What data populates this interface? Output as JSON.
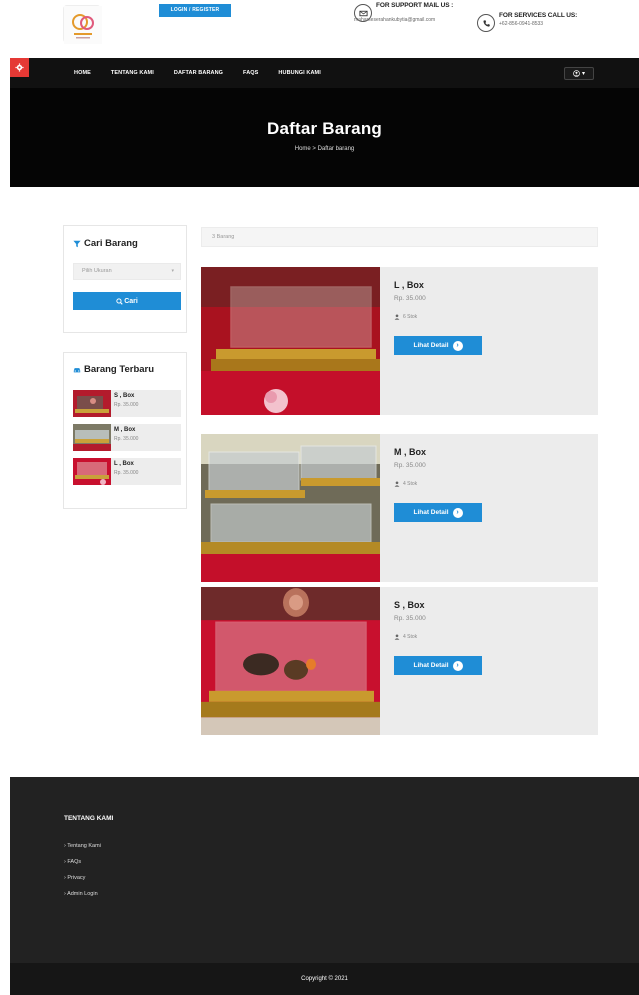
{
  "header": {
    "login_label": "LOGIN / REGISTER",
    "support_title": "FOR SUPPORT MAIL US :",
    "support_email": "maharseserahankubytia@gmail.com",
    "call_title": "FOR SERVICES CALL US:",
    "call_number": "+62-856-0941-8533"
  },
  "nav": {
    "items": [
      "HOME",
      "TENTANG KAMI",
      "DAFTAR BARANG",
      "FAQS",
      "HUBUNGI KAMI"
    ],
    "user_caret": "▾"
  },
  "hero": {
    "title": "Daftar Barang",
    "breadcrumb": "Home > Daftar barang"
  },
  "sidebar": {
    "search_title": "Cari Barang",
    "size_placeholder": "Pilih Ukuran",
    "search_button": "Cari",
    "latest_title": "Barang Terbaru",
    "latest": [
      {
        "name": "S , Box",
        "price": "Rp. 35.000"
      },
      {
        "name": "M , Box",
        "price": "Rp. 35.000"
      },
      {
        "name": "L , Box",
        "price": "Rp. 35.000"
      }
    ]
  },
  "content": {
    "count_text": "3 Barang",
    "detail_label": "Lihat Detail",
    "products": [
      {
        "name": "L , Box",
        "price": "Rp. 35.000",
        "stock": "6 Stok"
      },
      {
        "name": "M , Box",
        "price": "Rp. 35.000",
        "stock": "4 Stok"
      },
      {
        "name": "S , Box",
        "price": "Rp. 35.000",
        "stock": "4 Stok"
      }
    ]
  },
  "footer": {
    "heading": "TENTANG KAMI",
    "links": [
      "Tentang Kami",
      "FAQs",
      "Privacy",
      "Admin Login"
    ],
    "copyright": "Copyright © 2021"
  },
  "colors": {
    "accent": "#1f8dd6",
    "nav_bg": "#111111",
    "gear_red": "#e53935",
    "footer_bg": "#222222"
  },
  "icons": {
    "gear": "gear-icon",
    "filter": "filter-icon",
    "search": "search-icon",
    "car": "car-icon",
    "user": "user-icon",
    "mail": "mail-icon",
    "phone": "phone-icon",
    "arrow": "arrow-right-icon"
  }
}
